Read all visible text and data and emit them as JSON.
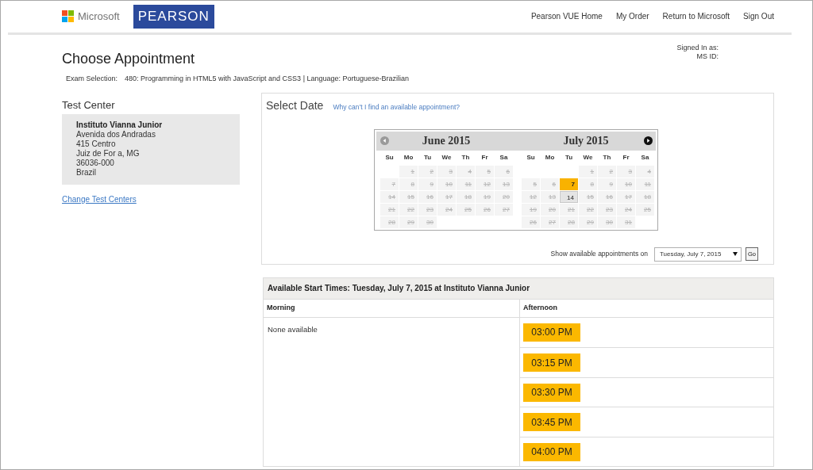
{
  "header": {
    "brand_name": "Microsoft",
    "brand_logo": "PEARSON",
    "nav_links": [
      "Pearson VUE Home",
      "My Order",
      "Return to Microsoft",
      "Sign Out"
    ]
  },
  "page": {
    "title": "Choose Appointment",
    "signed_in": [
      "Signed In as:",
      "MS ID:"
    ],
    "exam_selection": {
      "label": "Exam Selection:",
      "value": "480: Programming in HTML5 with JavaScript and CSS3 | Language: Portuguese-Brazilian"
    }
  },
  "test_center": {
    "heading": "Test Center",
    "name": "Instituto Vianna Junior",
    "address": [
      "Avenida dos Andradas",
      "415 Centro",
      "Juiz de For a, MG",
      "36036-000",
      "Brazil"
    ],
    "change_link": "Change Test Centers"
  },
  "select_date": {
    "heading": "Select Date",
    "help_link": "Why can’t I find an available appointment?",
    "calendar": {
      "prev": {
        "disabled": true
      },
      "next": {
        "disabled": false
      },
      "months": [
        {
          "title": "June 2015",
          "weekdays": [
            "Su",
            "Mo",
            "Tu",
            "We",
            "Th",
            "Fr",
            "Sa"
          ],
          "days": [
            {
              "kind": "blank"
            },
            {
              "kind": "day",
              "label": "1",
              "available": false,
              "selected": false
            },
            {
              "kind": "day",
              "label": "2",
              "available": false,
              "selected": false
            },
            {
              "kind": "day",
              "label": "3",
              "available": false,
              "selected": false
            },
            {
              "kind": "day",
              "label": "4",
              "available": false,
              "selected": false
            },
            {
              "kind": "day",
              "label": "5",
              "available": false,
              "selected": false
            },
            {
              "kind": "day",
              "label": "6",
              "available": false,
              "selected": false
            },
            {
              "kind": "day",
              "label": "7",
              "available": false,
              "selected": false
            },
            {
              "kind": "day",
              "label": "8",
              "available": false,
              "selected": false
            },
            {
              "kind": "day",
              "label": "9",
              "available": false,
              "selected": false
            },
            {
              "kind": "day",
              "label": "10",
              "available": false,
              "selected": false
            },
            {
              "kind": "day",
              "label": "11",
              "available": false,
              "selected": false
            },
            {
              "kind": "day",
              "label": "12",
              "available": false,
              "selected": false
            },
            {
              "kind": "day",
              "label": "13",
              "available": false,
              "selected": false
            },
            {
              "kind": "day",
              "label": "14",
              "available": false,
              "selected": false
            },
            {
              "kind": "day",
              "label": "15",
              "available": false,
              "selected": false
            },
            {
              "kind": "day",
              "label": "16",
              "available": false,
              "selected": false
            },
            {
              "kind": "day",
              "label": "17",
              "available": false,
              "selected": false
            },
            {
              "kind": "day",
              "label": "18",
              "available": false,
              "selected": false
            },
            {
              "kind": "day",
              "label": "19",
              "available": false,
              "selected": false
            },
            {
              "kind": "day",
              "label": "20",
              "available": false,
              "selected": false
            },
            {
              "kind": "day",
              "label": "21",
              "available": false,
              "selected": false
            },
            {
              "kind": "day",
              "label": "22",
              "available": false,
              "selected": false
            },
            {
              "kind": "day",
              "label": "23",
              "available": false,
              "selected": false
            },
            {
              "kind": "day",
              "label": "24",
              "available": false,
              "selected": false
            },
            {
              "kind": "day",
              "label": "25",
              "available": false,
              "selected": false
            },
            {
              "kind": "day",
              "label": "26",
              "available": false,
              "selected": false
            },
            {
              "kind": "day",
              "label": "27",
              "available": false,
              "selected": false
            },
            {
              "kind": "day",
              "label": "28",
              "available": false,
              "selected": false
            },
            {
              "kind": "day",
              "label": "29",
              "available": false,
              "selected": false
            },
            {
              "kind": "day",
              "label": "30",
              "available": false,
              "selected": false
            }
          ]
        },
        {
          "title": "July 2015",
          "weekdays": [
            "Su",
            "Mo",
            "Tu",
            "We",
            "Th",
            "Fr",
            "Sa"
          ],
          "days": [
            {
              "kind": "blank"
            },
            {
              "kind": "blank"
            },
            {
              "kind": "blank"
            },
            {
              "kind": "day",
              "label": "1",
              "available": false,
              "selected": false
            },
            {
              "kind": "day",
              "label": "2",
              "available": false,
              "selected": false
            },
            {
              "kind": "day",
              "label": "3",
              "available": false,
              "selected": false
            },
            {
              "kind": "day",
              "label": "4",
              "available": false,
              "selected": false
            },
            {
              "kind": "day",
              "label": "5",
              "available": false,
              "selected": false
            },
            {
              "kind": "day",
              "label": "6",
              "available": false,
              "selected": false
            },
            {
              "kind": "day",
              "label": "7",
              "available": true,
              "selected": true
            },
            {
              "kind": "day",
              "label": "8",
              "available": false,
              "selected": false
            },
            {
              "kind": "day",
              "label": "9",
              "available": false,
              "selected": false
            },
            {
              "kind": "day",
              "label": "10",
              "available": false,
              "selected": false
            },
            {
              "kind": "day",
              "label": "11",
              "available": false,
              "selected": false
            },
            {
              "kind": "day",
              "label": "12",
              "available": false,
              "selected": false
            },
            {
              "kind": "day",
              "label": "13",
              "available": false,
              "selected": false
            },
            {
              "kind": "day",
              "label": "14",
              "available": true,
              "selected": false
            },
            {
              "kind": "day",
              "label": "15",
              "available": false,
              "selected": false
            },
            {
              "kind": "day",
              "label": "16",
              "available": false,
              "selected": false
            },
            {
              "kind": "day",
              "label": "17",
              "available": false,
              "selected": false
            },
            {
              "kind": "day",
              "label": "18",
              "available": false,
              "selected": false
            },
            {
              "kind": "day",
              "label": "19",
              "available": false,
              "selected": false
            },
            {
              "kind": "day",
              "label": "20",
              "available": false,
              "selected": false
            },
            {
              "kind": "day",
              "label": "21",
              "available": false,
              "selected": false
            },
            {
              "kind": "day",
              "label": "22",
              "available": false,
              "selected": false
            },
            {
              "kind": "day",
              "label": "23",
              "available": false,
              "selected": false
            },
            {
              "kind": "day",
              "label": "24",
              "available": false,
              "selected": false
            },
            {
              "kind": "day",
              "label": "25",
              "available": false,
              "selected": false
            },
            {
              "kind": "day",
              "label": "26",
              "available": false,
              "selected": false
            },
            {
              "kind": "day",
              "label": "27",
              "available": false,
              "selected": false
            },
            {
              "kind": "day",
              "label": "28",
              "available": false,
              "selected": false
            },
            {
              "kind": "day",
              "label": "29",
              "available": false,
              "selected": false
            },
            {
              "kind": "day",
              "label": "30",
              "available": false,
              "selected": false
            },
            {
              "kind": "day",
              "label": "31",
              "available": false,
              "selected": false
            }
          ]
        }
      ]
    },
    "show_on": {
      "label": "Show available appointments on",
      "value": "Tuesday, July 7, 2015",
      "go": "Go"
    }
  },
  "start_times": {
    "title": "Available Start Times: Tuesday, July 7, 2015 at Instituto Vianna Junior",
    "columns": [
      {
        "heading": "Morning",
        "empty_text": "None available"
      },
      {
        "heading": "Afternoon",
        "times": [
          "03:00 PM",
          "03:15 PM",
          "03:30 PM",
          "03:45 PM",
          "04:00 PM"
        ]
      }
    ]
  }
}
